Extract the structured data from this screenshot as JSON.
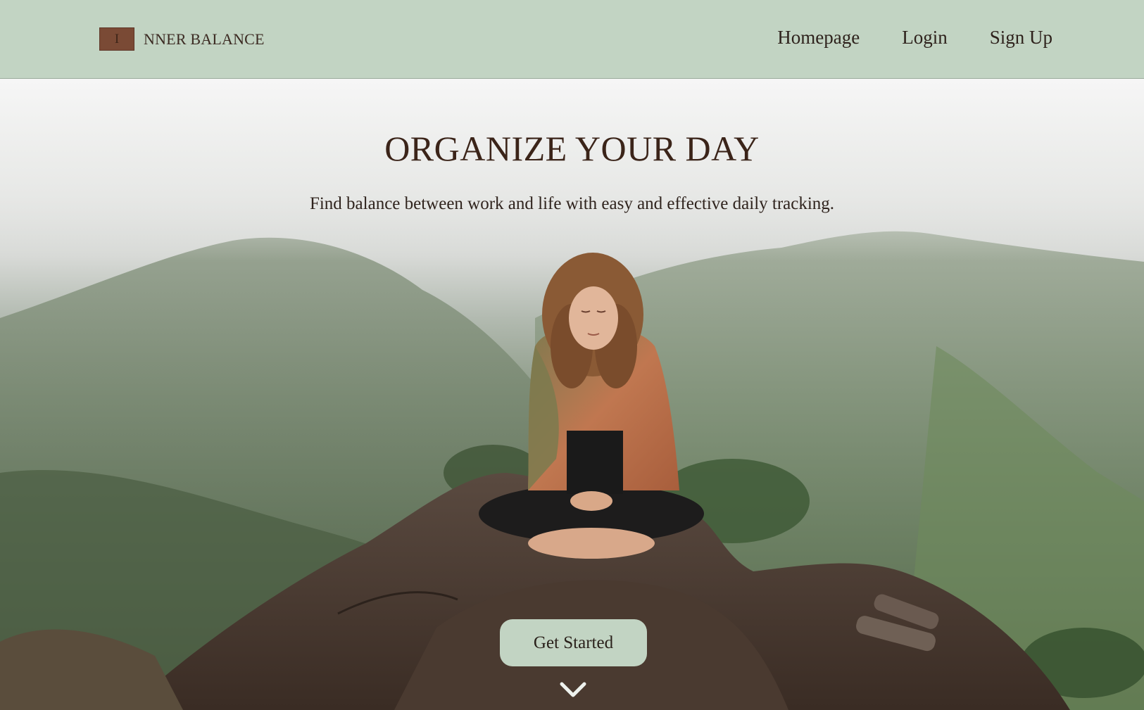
{
  "brand": {
    "logo_letter": "I",
    "name": "NNER BALANCE"
  },
  "nav": {
    "items": [
      {
        "label": "Homepage"
      },
      {
        "label": "Login"
      },
      {
        "label": "Sign Up"
      }
    ]
  },
  "hero": {
    "title": "ORGANIZE YOUR DAY",
    "subtitle": "Find balance between work and life with easy and effective daily tracking.",
    "cta_label": "Get Started",
    "scroll_icon": "chevron-down-icon",
    "background_image": "person meditating cross-legged on a rock above misty green mountains"
  },
  "colors": {
    "nav_background": "#c2d4c3",
    "logo_background": "#7a4a35",
    "title_color": "#3b2419",
    "button_background": "#c2d4c3"
  }
}
